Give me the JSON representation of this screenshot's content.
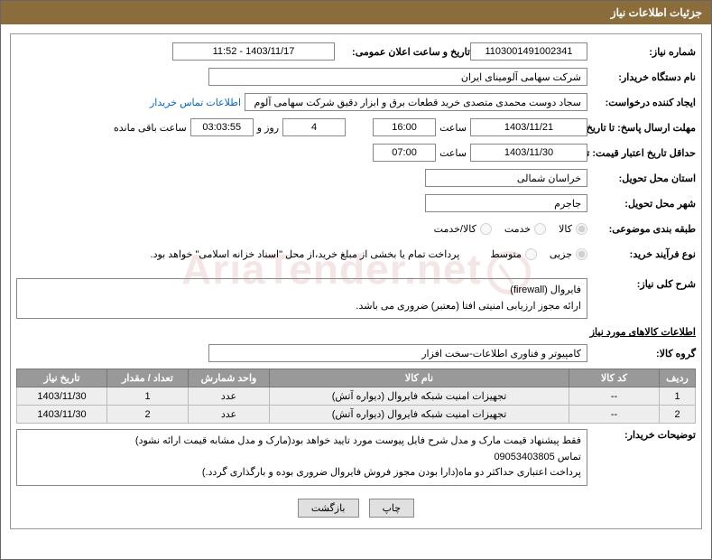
{
  "header": "جزئیات اطلاعات نیاز",
  "f": {
    "need_no_lbl": "شماره نیاز:",
    "need_no": "1103001491002341",
    "announce_lbl": "تاریخ و ساعت اعلان عمومی:",
    "announce_val": "1403/11/17 - 11:52",
    "buyer_org_lbl": "نام دستگاه خریدار:",
    "buyer_org": "شرکت سهامی آلومینای ایران",
    "requester_lbl": "ایجاد کننده درخواست:",
    "requester": "سجاد دوست محمدی متصدی خرید قطعات برق و ابزار دقیق شرکت سهامی آلوم",
    "contact_link": "اطلاعات تماس خریدار",
    "resp_due_lbl": "مهلت ارسال پاسخ: تا تاریخ:",
    "resp_due_date": "1403/11/21",
    "time_lbl": "ساعت",
    "resp_due_time": "16:00",
    "day_word": "روز و",
    "days_left": "4",
    "countdown": "03:03:55",
    "remain_lbl": "ساعت باقی مانده",
    "price_valid_lbl": "حداقل تاریخ اعتبار قیمت: تا تاریخ:",
    "price_valid_date": "1403/11/30",
    "price_valid_time": "07:00",
    "prov_lbl": "استان محل تحویل:",
    "prov": "خراسان شمالی",
    "city_lbl": "شهر محل تحویل:",
    "city": "جاجرم",
    "topic_lbl": "طبقه بندی موضوعی:",
    "r_goods": "کالا",
    "r_service": "خدمت",
    "r_both": "کالا/خدمت",
    "proc_lbl": "نوع فرآیند خرید:",
    "r_partial": "جزیی",
    "r_medium": "متوسط",
    "proc_note": "پرداخت تمام یا بخشی از مبلغ خرید،از محل \"اسناد خزانه اسلامی\" خواهد بود.",
    "desc_lbl": "شرح کلی نیاز:",
    "desc": "فایروال (firewall)\nارائه مجوز ارزیابی امنیتی افتا (معتبر) ضروری می باشد.",
    "items_title": "اطلاعات کالاهای مورد نیاز",
    "group_lbl": "گروه کالا:",
    "group": "کامپیوتر و فناوری اطلاعات-سخت افزار",
    "notes_lbl": "توضیحات خریدار:",
    "notes": "فقط پیشنهاد قیمت مارک و مدل شرح فایل پیوست مورد تایید خواهد بود(مارک و مدل مشابه قیمت ارائه نشود)\nتماس 09053403805\nپرداخت اعتباری حداکثر دو ماه(دارا بودن مجوز فروش فایروال ضروری بوده و بارگذاری گردد.)"
  },
  "tbl": {
    "h": [
      "ردیف",
      "کد کالا",
      "نام کالا",
      "واحد شمارش",
      "تعداد / مقدار",
      "تاریخ نیاز"
    ],
    "rows": [
      {
        "n": "1",
        "code": "--",
        "name": "تجهیزات امنیت شبکه فایروال (دیواره آتش)",
        "unit": "عدد",
        "qty": "1",
        "date": "1403/11/30"
      },
      {
        "n": "2",
        "code": "--",
        "name": "تجهیزات امنیت شبکه فایروال (دیواره آتش)",
        "unit": "عدد",
        "qty": "2",
        "date": "1403/11/30"
      }
    ]
  },
  "btns": {
    "print": "چاپ",
    "back": "بازگشت"
  },
  "watermark": "AriaTender.net"
}
